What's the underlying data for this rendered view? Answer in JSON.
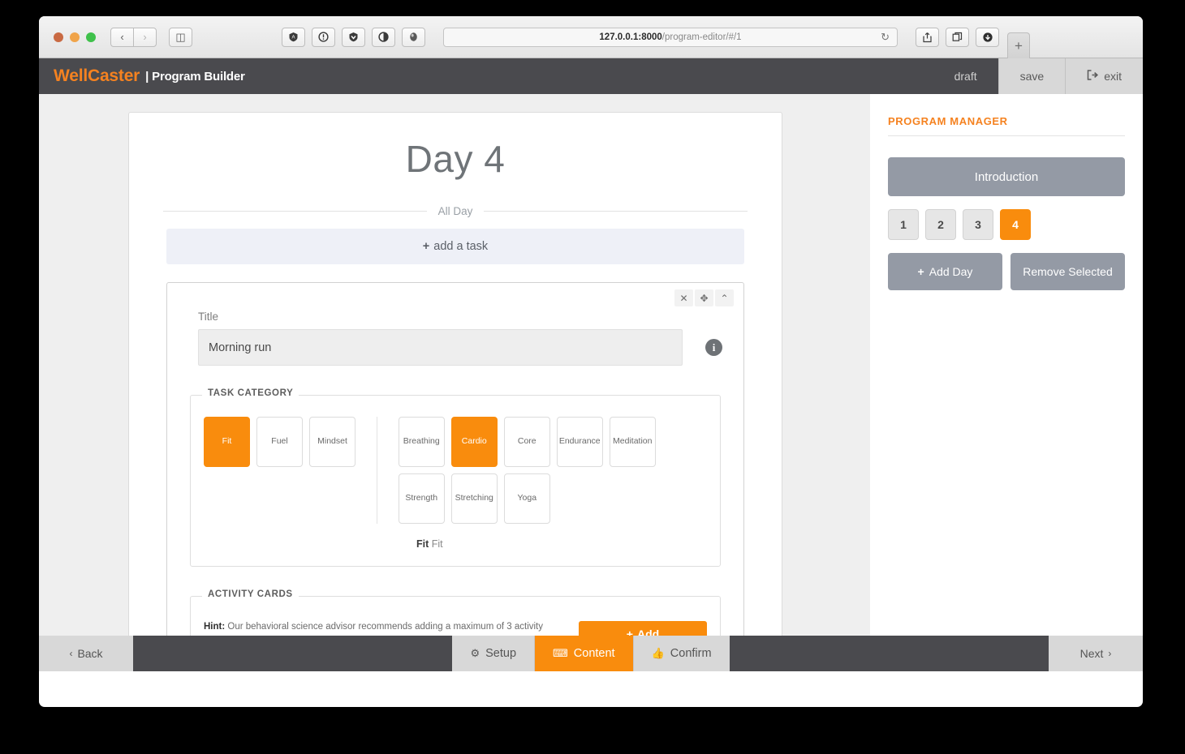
{
  "browser": {
    "url_host": "127.0.0.1:8000",
    "url_path": "/program-editor/#/1",
    "back_icon": "‹",
    "forward_icon": "›",
    "sidebar_icon": "◫",
    "reload_icon": "↻",
    "extensions": [
      "●",
      "ⓘ",
      "▼",
      "◐",
      "●"
    ],
    "share_icon": "⇧",
    "tabs_icon": "⧉",
    "download_icon": "↓",
    "new_tab_icon": "+"
  },
  "header": {
    "brand_name": "WellCaster",
    "brand_sub": "| Program Builder",
    "draft_label": "draft",
    "save_label": "save",
    "exit_label": "exit",
    "exit_icon": "↪"
  },
  "main": {
    "day_title": "Day 4",
    "all_day_label": "All Day",
    "add_task_label": "add a task",
    "plus_icon": "+",
    "card_controls": {
      "close_icon": "✕",
      "move_icon": "✥",
      "collapse_icon": "⌃"
    },
    "title_field": {
      "label": "Title",
      "value": "Morning run",
      "info_icon": "i"
    },
    "task_category": {
      "legend": "TASK CATEGORY",
      "primary": [
        {
          "label": "Fit",
          "selected": true
        },
        {
          "label": "Fuel",
          "selected": false
        },
        {
          "label": "Mindset",
          "selected": false
        }
      ],
      "secondary": [
        {
          "label": "Breathing",
          "selected": false
        },
        {
          "label": "Cardio",
          "selected": true
        },
        {
          "label": "Core",
          "selected": false
        },
        {
          "label": "Endurance",
          "selected": false
        },
        {
          "label": "Meditation",
          "selected": false
        },
        {
          "label": "Strength",
          "selected": false
        },
        {
          "label": "Stretching",
          "selected": false
        },
        {
          "label": "Yoga",
          "selected": false
        }
      ],
      "summary_bold": "Fit",
      "summary_rest": "Fit"
    },
    "activity_cards": {
      "legend": "ACTIVITY CARDS",
      "hint_label": "Hint:",
      "hint_text": " Our behavioral science advisor recommends adding a maximum of 3 activity options to a task. Complimenting general tasks with content-rich activity cards adds freedom of choice within structure, resulting in more engagement with you and your program. Add workouts of different intensities to a fit task; different recipes or meal ideas to a fuel task; meditations for different moods, or stretches targeting different joints or pain points.",
      "add_label": "Add",
      "add_plus": "+"
    }
  },
  "panel": {
    "title": "PROGRAM MANAGER",
    "introduction_label": "Introduction",
    "days": [
      {
        "label": "1",
        "active": false
      },
      {
        "label": "2",
        "active": false
      },
      {
        "label": "3",
        "active": false
      },
      {
        "label": "4",
        "active": true
      }
    ],
    "add_day_label": "Add Day",
    "add_day_plus": "+",
    "remove_selected_label": "Remove Selected"
  },
  "footer": {
    "back_label": "Back",
    "back_icon": "‹",
    "next_label": "Next",
    "next_icon": "›",
    "tabs": [
      {
        "label": "Setup",
        "icon": "⚙",
        "active": false
      },
      {
        "label": "Content",
        "icon": "⌨",
        "active": true
      },
      {
        "label": "Confirm",
        "icon": "👍",
        "active": false
      }
    ]
  },
  "colors": {
    "accent_orange": "#f98c0d",
    "brand_orange": "#f58220",
    "header_dark": "#4a4a4e",
    "panel_gray": "#949aa5"
  }
}
